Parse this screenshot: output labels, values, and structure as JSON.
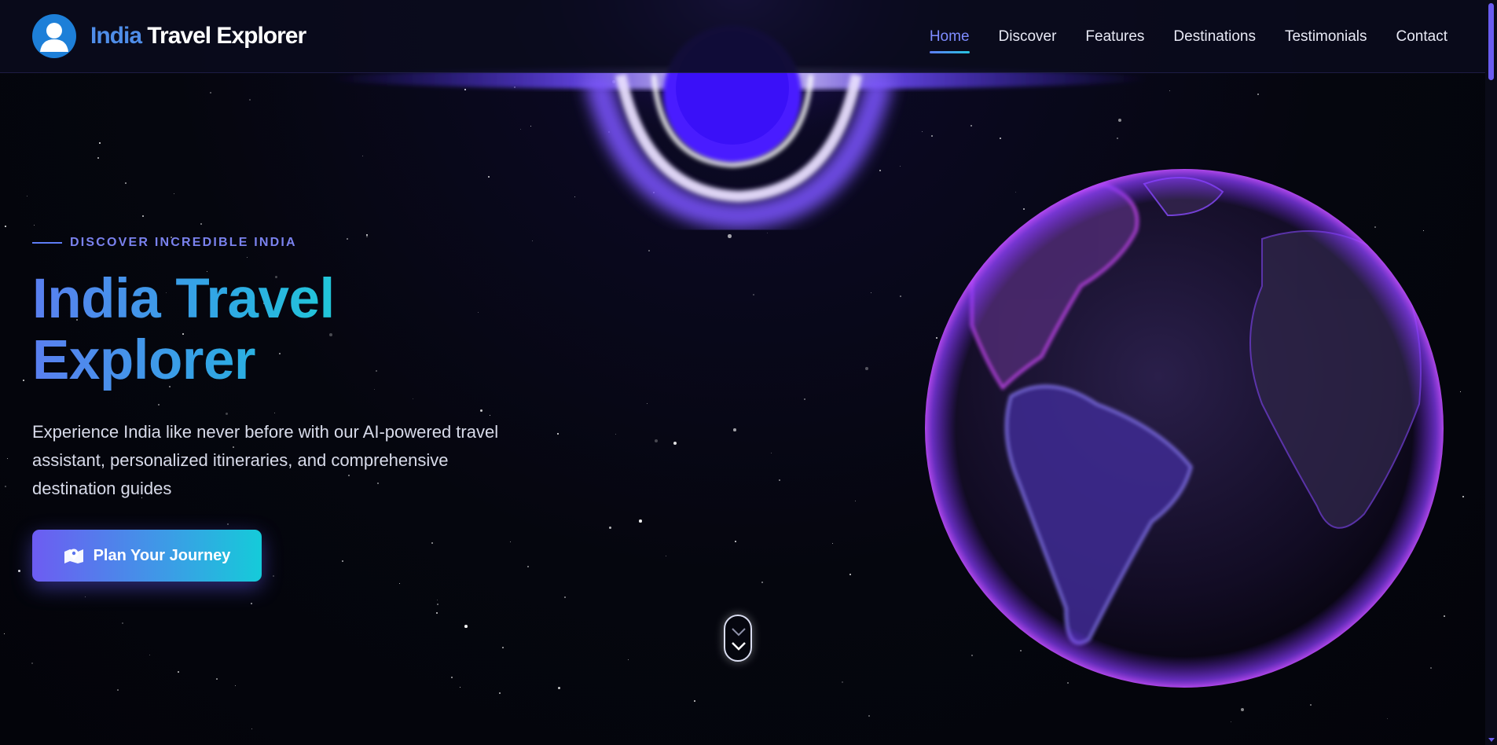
{
  "brand": {
    "accent_word": "India",
    "rest": "Travel Explorer",
    "logo_icon": "user-avatar-icon"
  },
  "nav": {
    "items": [
      {
        "label": "Home",
        "active": true
      },
      {
        "label": "Discover",
        "active": false
      },
      {
        "label": "Features",
        "active": false
      },
      {
        "label": "Destinations",
        "active": false
      },
      {
        "label": "Testimonials",
        "active": false
      },
      {
        "label": "Contact",
        "active": false
      }
    ]
  },
  "hero": {
    "tagline": "DISCOVER INCREDIBLE INDIA",
    "title_line1": "India Travel",
    "title_line2": "Explorer",
    "description": "Experience India like never before with our AI-powered travel assistant, personalized itineraries, and comprehensive destination guides",
    "cta_label": "Plan Your Journey",
    "cta_icon": "map-marker-icon"
  },
  "scroll_indicator": {
    "icon": "chevron-down-icon"
  },
  "colors": {
    "background": "#05060e",
    "accent_purple": "#6d5cf2",
    "accent_cyan": "#15cbd9",
    "nav_active": "#7e8cff",
    "blackhole_glow": "#5a30ff"
  }
}
